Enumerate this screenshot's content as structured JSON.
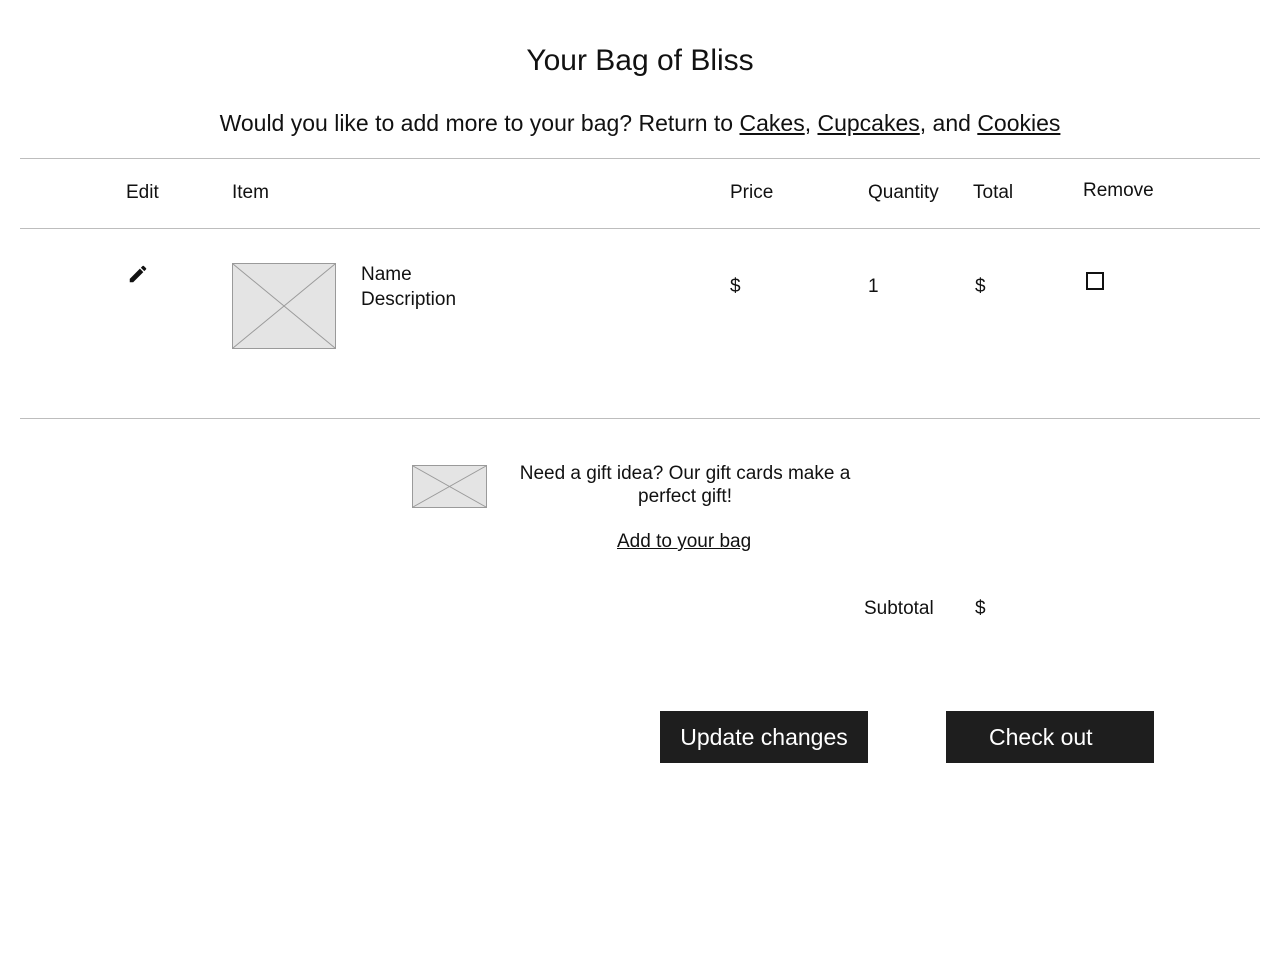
{
  "page": {
    "title": "Your Bag of Bliss",
    "prompt_text": "Would you like to add more to your bag? Return to ",
    "links": [
      "Cakes",
      "Cupcakes",
      "Cookies"
    ],
    "sep1": ", ",
    "sep2": ", and "
  },
  "table": {
    "headers": {
      "edit": "Edit",
      "item": "Item",
      "price": "Price",
      "quantity": "Quantity",
      "total": "Total",
      "remove": "Remove"
    },
    "rows": [
      {
        "name": "Name",
        "description": "Description",
        "price": "$",
        "quantity": "1",
        "total": "$",
        "edit_icon": "pencil-icon",
        "remove_checked": false
      }
    ]
  },
  "gift": {
    "text": "Need a gift idea? Our gift cards make a perfect gift!",
    "link": "Add to your bag"
  },
  "summary": {
    "subtotal_label": "Subtotal",
    "subtotal_value": "$"
  },
  "buttons": {
    "update": "Update changes",
    "checkout": "Check out"
  }
}
